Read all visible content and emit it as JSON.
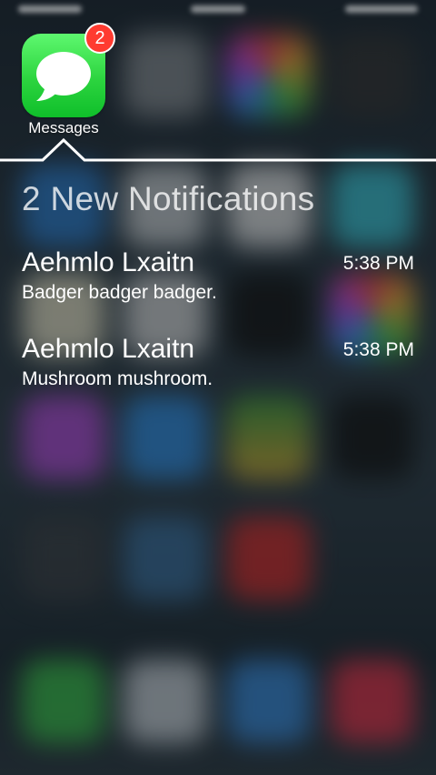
{
  "app": {
    "name": "Messages",
    "badge_count": "2",
    "icon": "messages-bubble-icon"
  },
  "notification_center": {
    "heading": "2 New Notifications",
    "items": [
      {
        "sender": "Aehmlo Lxaitn",
        "time": "5:38 PM",
        "message": "Badger badger badger."
      },
      {
        "sender": "Aehmlo Lxaitn",
        "time": "5:38 PM",
        "message": "Mushroom mushroom."
      }
    ]
  },
  "colors": {
    "app_green": "#2cd43f",
    "badge_red": "#ff3b30",
    "divider": "#ffffff"
  }
}
